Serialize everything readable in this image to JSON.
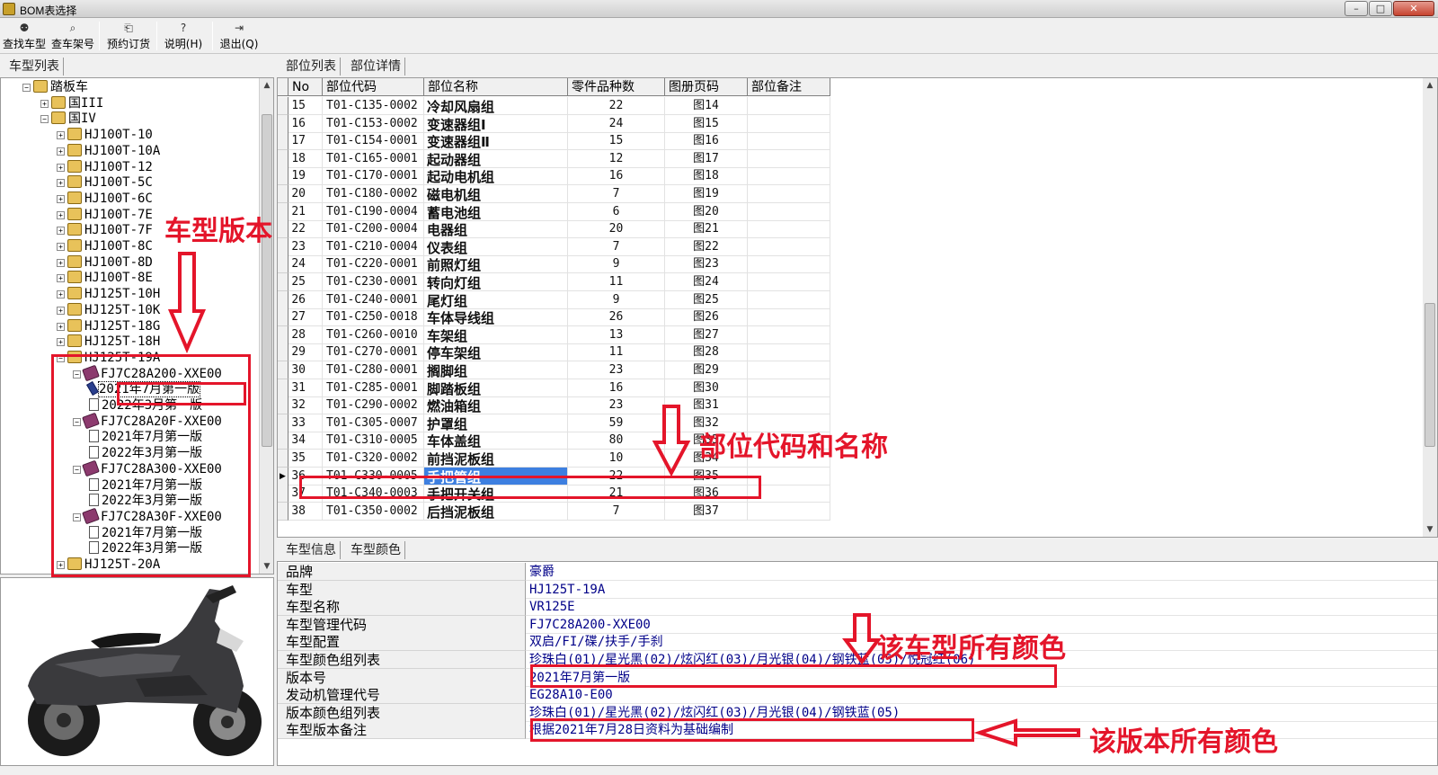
{
  "window": {
    "title": "BOM表选择",
    "min_label": "–",
    "max_label": "□",
    "close_label": "✕"
  },
  "toolbar": [
    {
      "label": "查找车型",
      "icon": "binoculars-icon",
      "glyph": "⚉"
    },
    {
      "label": "查车架号",
      "icon": "magnifier-icon",
      "glyph": "⌕"
    },
    {
      "label": "预约订货",
      "icon": "order-icon",
      "glyph": "⎗"
    },
    {
      "label": "说明(H)",
      "icon": "help-icon",
      "glyph": "?"
    },
    {
      "label": "退出(Q)",
      "icon": "exit-icon",
      "glyph": "⇥"
    }
  ],
  "left_tabs": {
    "models": "车型列表"
  },
  "top_tabs": {
    "parts_list": "部位列表",
    "parts_detail": "部位详情"
  },
  "bottom_tabs": {
    "model_info": "车型信息",
    "model_color": "车型颜色"
  },
  "tree": [
    "踏板车",
    "国III",
    "国IV",
    "HJ100T-10",
    "HJ100T-10A",
    "HJ100T-12",
    "HJ100T-5C",
    "HJ100T-6C",
    "HJ100T-7E",
    "HJ100T-7F",
    "HJ100T-8C",
    "HJ100T-8D",
    "HJ100T-8E",
    "HJ125T-10H",
    "HJ125T-10K",
    "HJ125T-18G",
    "HJ125T-18H",
    "HJ125T-19A",
    "FJ7C28A200-XXE00",
    "2021年7月第一版",
    "2022年3月第一版",
    "FJ7C28A20F-XXE00",
    "2021年7月第一版",
    "2022年3月第一版",
    "FJ7C28A300-XXE00",
    "2021年7月第一版",
    "2022年3月第一版",
    "FJ7C28A30F-XXE00",
    "2021年7月第一版",
    "2022年3月第一版",
    "HJ125T-20A"
  ],
  "grid": {
    "columns": [
      "No",
      "部位代码",
      "部位名称",
      "零件品种数",
      "图册页码",
      "部位备注"
    ],
    "rows": [
      [
        "15",
        "T01-C135-0002",
        "冷却风扇组",
        "22",
        "图14",
        ""
      ],
      [
        "16",
        "T01-C153-0002",
        "变速器组Ⅰ",
        "24",
        "图15",
        ""
      ],
      [
        "17",
        "T01-C154-0001",
        "变速器组Ⅱ",
        "15",
        "图16",
        ""
      ],
      [
        "18",
        "T01-C165-0001",
        "起动器组",
        "12",
        "图17",
        ""
      ],
      [
        "19",
        "T01-C170-0001",
        "起动电机组",
        "16",
        "图18",
        ""
      ],
      [
        "20",
        "T01-C180-0002",
        "磁电机组",
        "7",
        "图19",
        ""
      ],
      [
        "21",
        "T01-C190-0004",
        "蓄电池组",
        "6",
        "图20",
        ""
      ],
      [
        "22",
        "T01-C200-0004",
        "电器组",
        "20",
        "图21",
        ""
      ],
      [
        "23",
        "T01-C210-0004",
        "仪表组",
        "7",
        "图22",
        ""
      ],
      [
        "24",
        "T01-C220-0001",
        "前照灯组",
        "9",
        "图23",
        ""
      ],
      [
        "25",
        "T01-C230-0001",
        "转向灯组",
        "11",
        "图24",
        ""
      ],
      [
        "26",
        "T01-C240-0001",
        "尾灯组",
        "9",
        "图25",
        ""
      ],
      [
        "27",
        "T01-C250-0018",
        "车体导线组",
        "26",
        "图26",
        ""
      ],
      [
        "28",
        "T01-C260-0010",
        "车架组",
        "13",
        "图27",
        ""
      ],
      [
        "29",
        "T01-C270-0001",
        "停车架组",
        "11",
        "图28",
        ""
      ],
      [
        "30",
        "T01-C280-0001",
        "搁脚组",
        "23",
        "图29",
        ""
      ],
      [
        "31",
        "T01-C285-0001",
        "脚踏板组",
        "16",
        "图30",
        ""
      ],
      [
        "32",
        "T01-C290-0002",
        "燃油箱组",
        "23",
        "图31",
        ""
      ],
      [
        "33",
        "T01-C305-0007",
        "护罩组",
        "59",
        "图32",
        ""
      ],
      [
        "34",
        "T01-C310-0005",
        "车体盖组",
        "80",
        "图33",
        ""
      ],
      [
        "35",
        "T01-C320-0002",
        "前挡泥板组",
        "10",
        "图34",
        ""
      ],
      [
        "36",
        "T01-C330-0005",
        "手把管组",
        "22",
        "图35",
        ""
      ],
      [
        "37",
        "T01-C340-0003",
        "手把开关组",
        "21",
        "图36",
        ""
      ],
      [
        "38",
        "T01-C350-0002",
        "后挡泥板组",
        "7",
        "图37",
        ""
      ]
    ],
    "selected_row_no": "36"
  },
  "info": [
    {
      "label": "品牌",
      "value": "豪爵"
    },
    {
      "label": "车型",
      "value": "HJ125T-19A"
    },
    {
      "label": "车型名称",
      "value": "VR125E"
    },
    {
      "label": "车型管理代码",
      "value": "FJ7C28A200-XXE00"
    },
    {
      "label": "车型配置",
      "value": "双启/FI/碟/扶手/手刹"
    },
    {
      "label": "车型颜色组列表",
      "value": "珍珠白(01)/星光黑(02)/炫闪红(03)/月光银(04)/钢铁蓝(05)/悦冠红(06)"
    },
    {
      "label": "版本号",
      "value": "2021年7月第一版"
    },
    {
      "label": "发动机管理代号",
      "value": "EG28A10-E00"
    },
    {
      "label": "版本颜色组列表",
      "value": "珍珠白(01)/星光黑(02)/炫闪红(03)/月光银(04)/钢铁蓝(05)"
    },
    {
      "label": "车型版本备注",
      "value": "根据2021年7月28日资料为基础编制"
    }
  ],
  "annotations": {
    "model_version": "车型版本",
    "part_code_name": "部位代码和名称",
    "model_all_colors": "该车型所有颜色",
    "version_all_colors": "该版本所有颜色"
  },
  "colors": {
    "annotation": "#e4152a",
    "selection": "#3d7fe0",
    "value_text": "#000088"
  }
}
